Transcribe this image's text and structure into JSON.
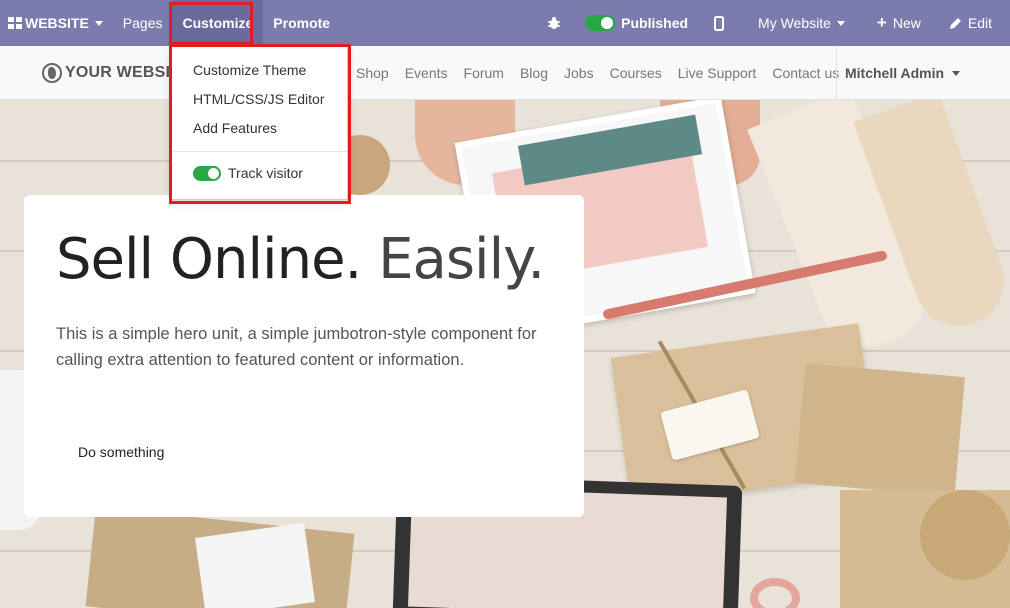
{
  "topbar": {
    "website_label": "WEBSITE",
    "pages_label": "Pages",
    "customize_label": "Customize",
    "promote_label": "Promote",
    "published_label": "Published",
    "my_website_label": "My Website",
    "new_label": "New",
    "edit_label": "Edit"
  },
  "site": {
    "logo_text": "YOUR WEBSIT",
    "nav": [
      "Shop",
      "Events",
      "Forum",
      "Blog",
      "Jobs",
      "Courses",
      "Live Support",
      "Contact us"
    ],
    "user_name": "Mitchell Admin"
  },
  "customize_menu": {
    "items": [
      "Customize Theme",
      "HTML/CSS/JS Editor",
      "Add Features"
    ],
    "track_visitor_label": "Track visitor",
    "track_visitor_on": true
  },
  "hero": {
    "title_bold": "Sell Online.",
    "title_light": "Easily.",
    "description": "This is a simple hero unit, a simple jumbotron-style component for calling extra attention to featured content or information.",
    "button_label": "Do something"
  },
  "colors": {
    "topbar": "#7c7bad",
    "toggle_on": "#28a745",
    "highlight": "#e31b23"
  }
}
